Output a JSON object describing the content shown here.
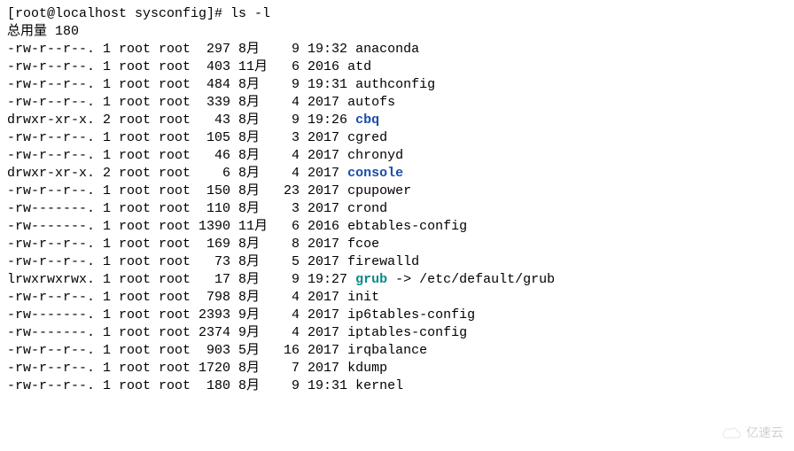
{
  "prompt_line": "[root@localhost sysconfig]# ls -l",
  "summary_line": "总用量 180",
  "watermark": "亿速云",
  "entries": [
    {
      "perm": "-rw-r--r--.",
      "links": "1",
      "owner": "root",
      "group": "root",
      "size": "297",
      "mon": "8月",
      "day": "9",
      "time": "19:32",
      "name": "anaconda",
      "cls": ""
    },
    {
      "perm": "-rw-r--r--.",
      "links": "1",
      "owner": "root",
      "group": "root",
      "size": "403",
      "mon": "11月",
      "day": "6",
      "time": "2016",
      "name": "atd",
      "cls": ""
    },
    {
      "perm": "-rw-r--r--.",
      "links": "1",
      "owner": "root",
      "group": "root",
      "size": "484",
      "mon": "8月",
      "day": "9",
      "time": "19:31",
      "name": "authconfig",
      "cls": ""
    },
    {
      "perm": "-rw-r--r--.",
      "links": "1",
      "owner": "root",
      "group": "root",
      "size": "339",
      "mon": "8月",
      "day": "4",
      "time": "2017",
      "name": "autofs",
      "cls": ""
    },
    {
      "perm": "drwxr-xr-x.",
      "links": "2",
      "owner": "root",
      "group": "root",
      "size": "43",
      "mon": "8月",
      "day": "9",
      "time": "19:26",
      "name": "cbq",
      "cls": "dirlink"
    },
    {
      "perm": "-rw-r--r--.",
      "links": "1",
      "owner": "root",
      "group": "root",
      "size": "105",
      "mon": "8月",
      "day": "3",
      "time": "2017",
      "name": "cgred",
      "cls": ""
    },
    {
      "perm": "-rw-r--r--.",
      "links": "1",
      "owner": "root",
      "group": "root",
      "size": "46",
      "mon": "8月",
      "day": "4",
      "time": "2017",
      "name": "chronyd",
      "cls": ""
    },
    {
      "perm": "drwxr-xr-x.",
      "links": "2",
      "owner": "root",
      "group": "root",
      "size": "6",
      "mon": "8月",
      "day": "4",
      "time": "2017",
      "name": "console",
      "cls": "dirlink"
    },
    {
      "perm": "-rw-r--r--.",
      "links": "1",
      "owner": "root",
      "group": "root",
      "size": "150",
      "mon": "8月",
      "day": "23",
      "time": "2017",
      "name": "cpupower",
      "cls": ""
    },
    {
      "perm": "-rw-------.",
      "links": "1",
      "owner": "root",
      "group": "root",
      "size": "110",
      "mon": "8月",
      "day": "3",
      "time": "2017",
      "name": "crond",
      "cls": ""
    },
    {
      "perm": "-rw-------.",
      "links": "1",
      "owner": "root",
      "group": "root",
      "size": "1390",
      "mon": "11月",
      "day": "6",
      "time": "2016",
      "name": "ebtables-config",
      "cls": ""
    },
    {
      "perm": "-rw-r--r--.",
      "links": "1",
      "owner": "root",
      "group": "root",
      "size": "169",
      "mon": "8月",
      "day": "8",
      "time": "2017",
      "name": "fcoe",
      "cls": ""
    },
    {
      "perm": "-rw-r--r--.",
      "links": "1",
      "owner": "root",
      "group": "root",
      "size": "73",
      "mon": "8月",
      "day": "5",
      "time": "2017",
      "name": "firewalld",
      "cls": ""
    },
    {
      "perm": "lrwxrwxrwx.",
      "links": "1",
      "owner": "root",
      "group": "root",
      "size": "17",
      "mon": "8月",
      "day": "9",
      "time": "19:27",
      "name": "grub",
      "cls": "symlink",
      "target": " -> /etc/default/grub"
    },
    {
      "perm": "-rw-r--r--.",
      "links": "1",
      "owner": "root",
      "group": "root",
      "size": "798",
      "mon": "8月",
      "day": "4",
      "time": "2017",
      "name": "init",
      "cls": ""
    },
    {
      "perm": "-rw-------.",
      "links": "1",
      "owner": "root",
      "group": "root",
      "size": "2393",
      "mon": "9月",
      "day": "4",
      "time": "2017",
      "name": "ip6tables-config",
      "cls": ""
    },
    {
      "perm": "-rw-------.",
      "links": "1",
      "owner": "root",
      "group": "root",
      "size": "2374",
      "mon": "9月",
      "day": "4",
      "time": "2017",
      "name": "iptables-config",
      "cls": ""
    },
    {
      "perm": "-rw-r--r--.",
      "links": "1",
      "owner": "root",
      "group": "root",
      "size": "903",
      "mon": "5月",
      "day": "16",
      "time": "2017",
      "name": "irqbalance",
      "cls": ""
    },
    {
      "perm": "-rw-r--r--.",
      "links": "1",
      "owner": "root",
      "group": "root",
      "size": "1720",
      "mon": "8月",
      "day": "7",
      "time": "2017",
      "name": "kdump",
      "cls": ""
    },
    {
      "perm": "-rw-r--r--.",
      "links": "1",
      "owner": "root",
      "group": "root",
      "size": "180",
      "mon": "8月",
      "day": "9",
      "time": "19:31",
      "name": "kernel",
      "cls": ""
    }
  ]
}
